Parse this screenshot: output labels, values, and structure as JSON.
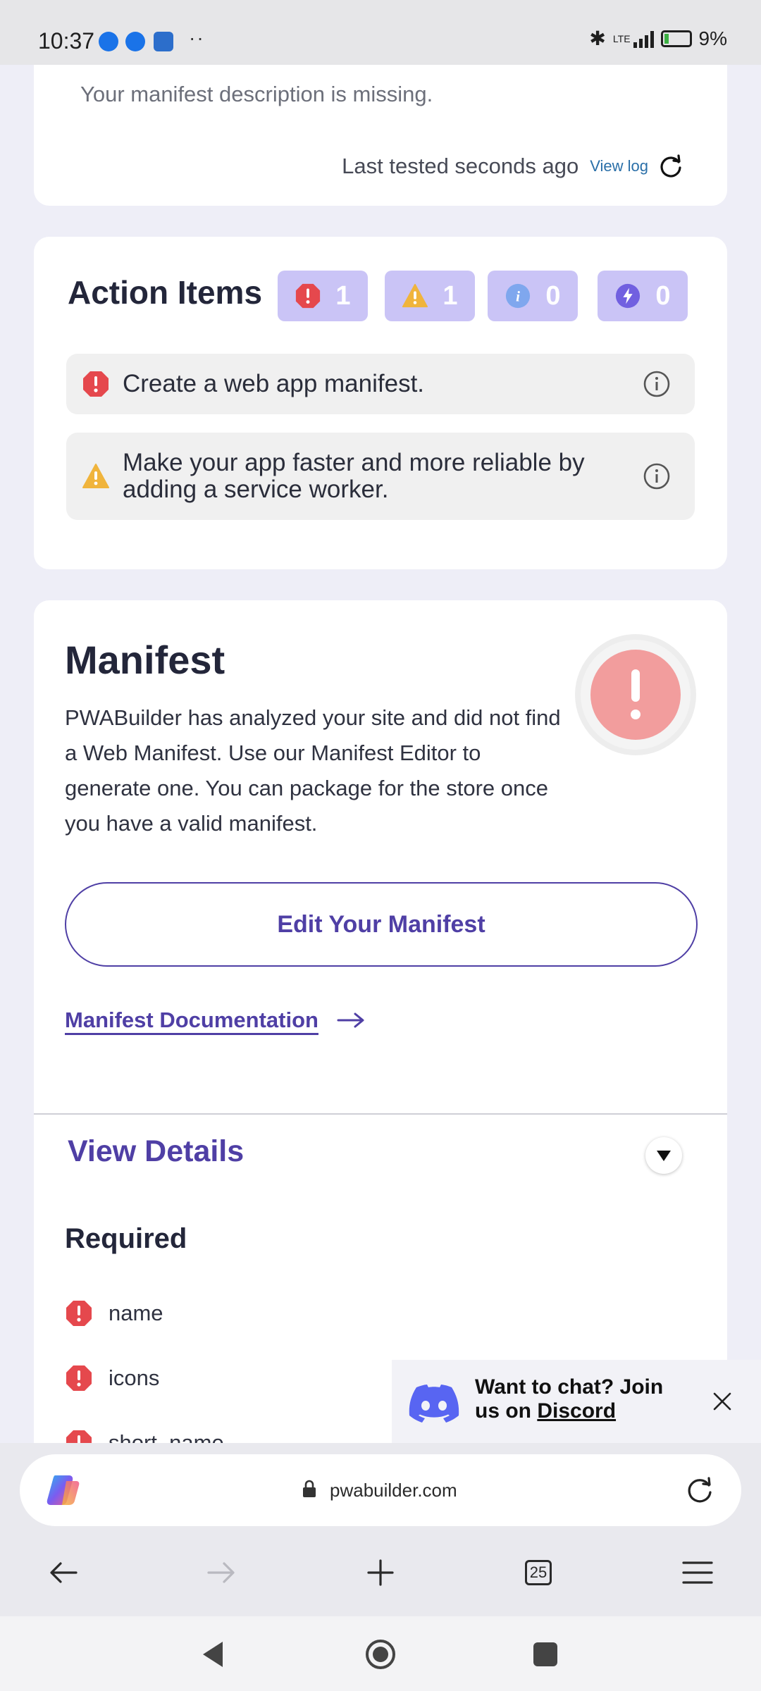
{
  "status_bar": {
    "time": "10:37",
    "overflow": "··",
    "network": "LTE",
    "battery": "9%"
  },
  "summary_card": {
    "description": "Your manifest description is missing.",
    "last_tested": "Last tested seconds ago",
    "view_log": "View log"
  },
  "action_items": {
    "title": "Action Items",
    "counts": {
      "errors": "1",
      "warnings": "1",
      "info": "0",
      "suggestions": "0"
    },
    "items": [
      {
        "text": "Create a web app manifest.",
        "severity": "error"
      },
      {
        "text": "Make your app faster and more reliable by adding a service worker.",
        "severity": "warning"
      }
    ]
  },
  "manifest": {
    "title": "Manifest",
    "body": "PWABuilder has analyzed your site and did not find a Web Manifest. Use our Manifest Editor to generate one. You can package for the store once you have a valid manifest.",
    "edit_button": "Edit Your Manifest",
    "doc_link": "Manifest Documentation",
    "view_details": "View Details",
    "required_title": "Required",
    "required_items": [
      "name",
      "icons",
      "short_name"
    ]
  },
  "discord": {
    "line": "Want to chat? Join us on",
    "link": "Discord"
  },
  "browser": {
    "url": "pwabuilder.com",
    "tab_count": "25"
  },
  "colors": {
    "accent": "#4f3fa5",
    "error": "#e5484d",
    "warning": "#f0b43c",
    "info": "#7fa7ee",
    "chip_bg": "#cac4f6"
  }
}
